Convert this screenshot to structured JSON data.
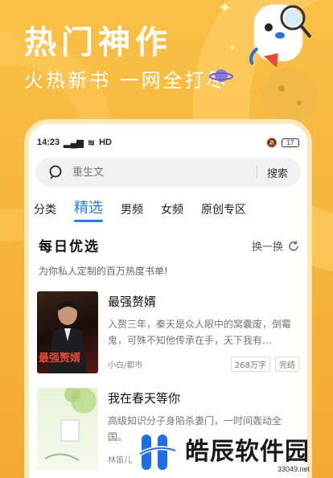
{
  "hero": {
    "title": "热门神作",
    "subtitle": "火热新书 一网全打尽"
  },
  "status_bar": {
    "time": "14:23",
    "network": "HD",
    "battery": "17"
  },
  "search": {
    "placeholder": "重生文",
    "button_label": "搜索"
  },
  "tabs": [
    {
      "label": "分类",
      "active": false
    },
    {
      "label": "精选",
      "active": true
    },
    {
      "label": "男频",
      "active": false
    },
    {
      "label": "女频",
      "active": false
    },
    {
      "label": "原创专区",
      "active": false
    }
  ],
  "section": {
    "title": "每日优选",
    "refresh_label": "换一换",
    "subtitle": "为你私人定制的百万热度书单!"
  },
  "books": [
    {
      "title": "最强赘婿",
      "description": "入赘三年，秦天是众人眼中的窝囊废，倒霉鬼，可殊不知他传承在手，天下我有…",
      "author": "小白/都市",
      "word_count": "268万字",
      "status": "完结",
      "cover_text": "最强赘婿"
    },
    {
      "title": "我在春天等你",
      "description": "高级知识分子身陷杀妻门，一时间轰动全国。",
      "author": "林笛儿",
      "word_count": "",
      "status": ""
    }
  ],
  "watermark": {
    "name": "皓辰软件园",
    "url": "33049.net"
  },
  "colors": {
    "background": "#F7B73A",
    "accent": "#2B7BE6"
  }
}
